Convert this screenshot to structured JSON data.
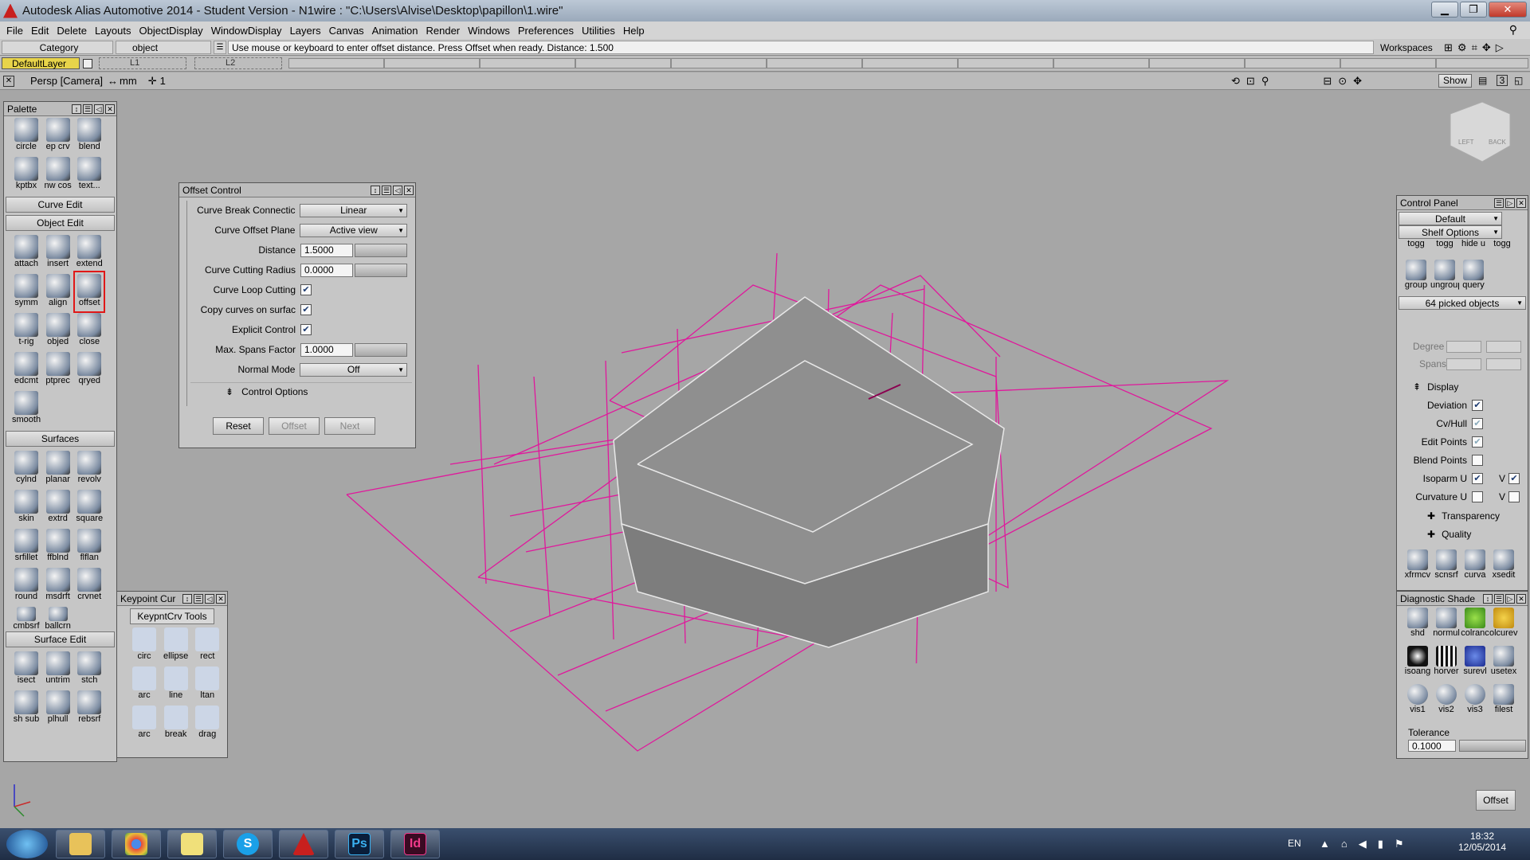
{
  "window": {
    "title": "Autodesk Alias Automotive 2014   - Student Version   - N1wire : \"C:\\Users\\Alvise\\Desktop\\papillon\\1.wire\""
  },
  "menu": [
    "File",
    "Edit",
    "Delete",
    "Layouts",
    "ObjectDisplay",
    "WindowDisplay",
    "Layers",
    "Canvas",
    "Animation",
    "Render",
    "Windows",
    "Preferences",
    "Utilities",
    "Help"
  ],
  "status": {
    "category": "Category",
    "object": "object",
    "prompt": "Use mouse or keyboard to enter offset distance. Press Offset when ready. Distance: 1.500",
    "workspaces": "Workspaces"
  },
  "layers": {
    "default_layer": "DefaultLayer",
    "l1": "L1",
    "l2": "L2"
  },
  "viewport": {
    "camera": "Persp [Camera]",
    "units": "mm",
    "zoom": "1",
    "show": "Show",
    "viewcube_left": "LEFT",
    "viewcube_back": "BACK",
    "layout_num": "3"
  },
  "palette": {
    "title": "Palette",
    "top_tools": [
      "circle",
      "ep crv",
      "blend",
      "kptbx",
      "nw cos",
      "text..."
    ],
    "curve_edit": "Curve Edit",
    "object_edit": "Object Edit",
    "object_tools": [
      "attach",
      "insert",
      "extend",
      "symm",
      "align",
      "offset",
      "t-rig",
      "objed",
      "close",
      "edcmt",
      "ptprec",
      "qryed",
      "smooth"
    ],
    "surfaces": "Surfaces",
    "surface_tools": [
      "cylnd",
      "planar",
      "revolv",
      "skin",
      "extrd",
      "square",
      "srfillet",
      "ffblnd",
      "flflan",
      "round",
      "msdrft",
      "crvnet",
      "cmbsrf",
      "ballcrn"
    ],
    "surface_edit": "Surface Edit",
    "surface_edit_tools": [
      "isect",
      "untrim",
      "stch",
      "sh sub",
      "plhull",
      "rebsrf"
    ]
  },
  "keypoint": {
    "title": "Keypoint Cur",
    "tab": "KeypntCrv Tools",
    "tools": [
      "circ",
      "ellipse",
      "rect",
      "arc",
      "line",
      "ltan",
      "arc",
      "break",
      "drag"
    ]
  },
  "offset_control": {
    "title": "Offset Control",
    "rows": [
      {
        "label": "Curve Break Connectic",
        "value": "Linear"
      },
      {
        "label": "Curve Offset Plane",
        "value": "Active view"
      },
      {
        "label": "Distance",
        "value": "1.5000"
      },
      {
        "label": "Curve Cutting Radius",
        "value": "0.0000"
      },
      {
        "label": "Curve Loop Cutting",
        "value": "✔"
      },
      {
        "label": "Copy curves on surfac",
        "value": "✔"
      },
      {
        "label": "Explicit Control",
        "value": "✔"
      },
      {
        "label": "Max. Spans Factor",
        "value": "1.0000"
      },
      {
        "label": "Normal Mode",
        "value": "Off"
      }
    ],
    "control_options": "Control Options",
    "reset": "Reset",
    "offset": "Offset",
    "next": "Next"
  },
  "control_panel": {
    "title": "Control Panel",
    "preset": "Default",
    "shelf": "Shelf Options",
    "shelf_tools": [
      "togg",
      "togg",
      "hide u",
      "togg",
      "group",
      "ungroup",
      "query"
    ],
    "picked": "64 picked objects",
    "degree": "Degree",
    "spans": "Spans",
    "display": "Display",
    "display_rows": [
      {
        "label": "Deviation",
        "checked": true
      },
      {
        "label": "Cv/Hull",
        "checked": true
      },
      {
        "label": "Edit Points",
        "checked": true
      },
      {
        "label": "Blend Points",
        "checked": false
      },
      {
        "label": "Isoparm U",
        "checked": true,
        "v": "V",
        "v_checked": true
      },
      {
        "label": "Curvature U",
        "checked": false,
        "v": "V",
        "v_checked": false
      }
    ],
    "transparency": "Transparency",
    "quality": "Quality",
    "bottom_tools": [
      "xfrmcv",
      "scnsrf",
      "curva",
      "xsedit"
    ]
  },
  "diagnostic": {
    "title": "Diagnostic Shade",
    "tools": [
      "shd",
      "normul",
      "colranc",
      "olcurevl",
      "isoang",
      "horver",
      "surevl",
      "usetex",
      "vis1",
      "vis2",
      "vis3",
      "filest"
    ],
    "tolerance_label": "Tolerance",
    "tolerance": "0.1000"
  },
  "offset_status_btn": "Offset",
  "taskbar": {
    "lang": "EN",
    "time": "18:32",
    "date": "12/05/2014",
    "ps": "Ps",
    "id": "Id"
  },
  "colors": {
    "wire": "#e0189c",
    "viewport": "#a6a6a6",
    "panel": "#c6c6c6"
  }
}
